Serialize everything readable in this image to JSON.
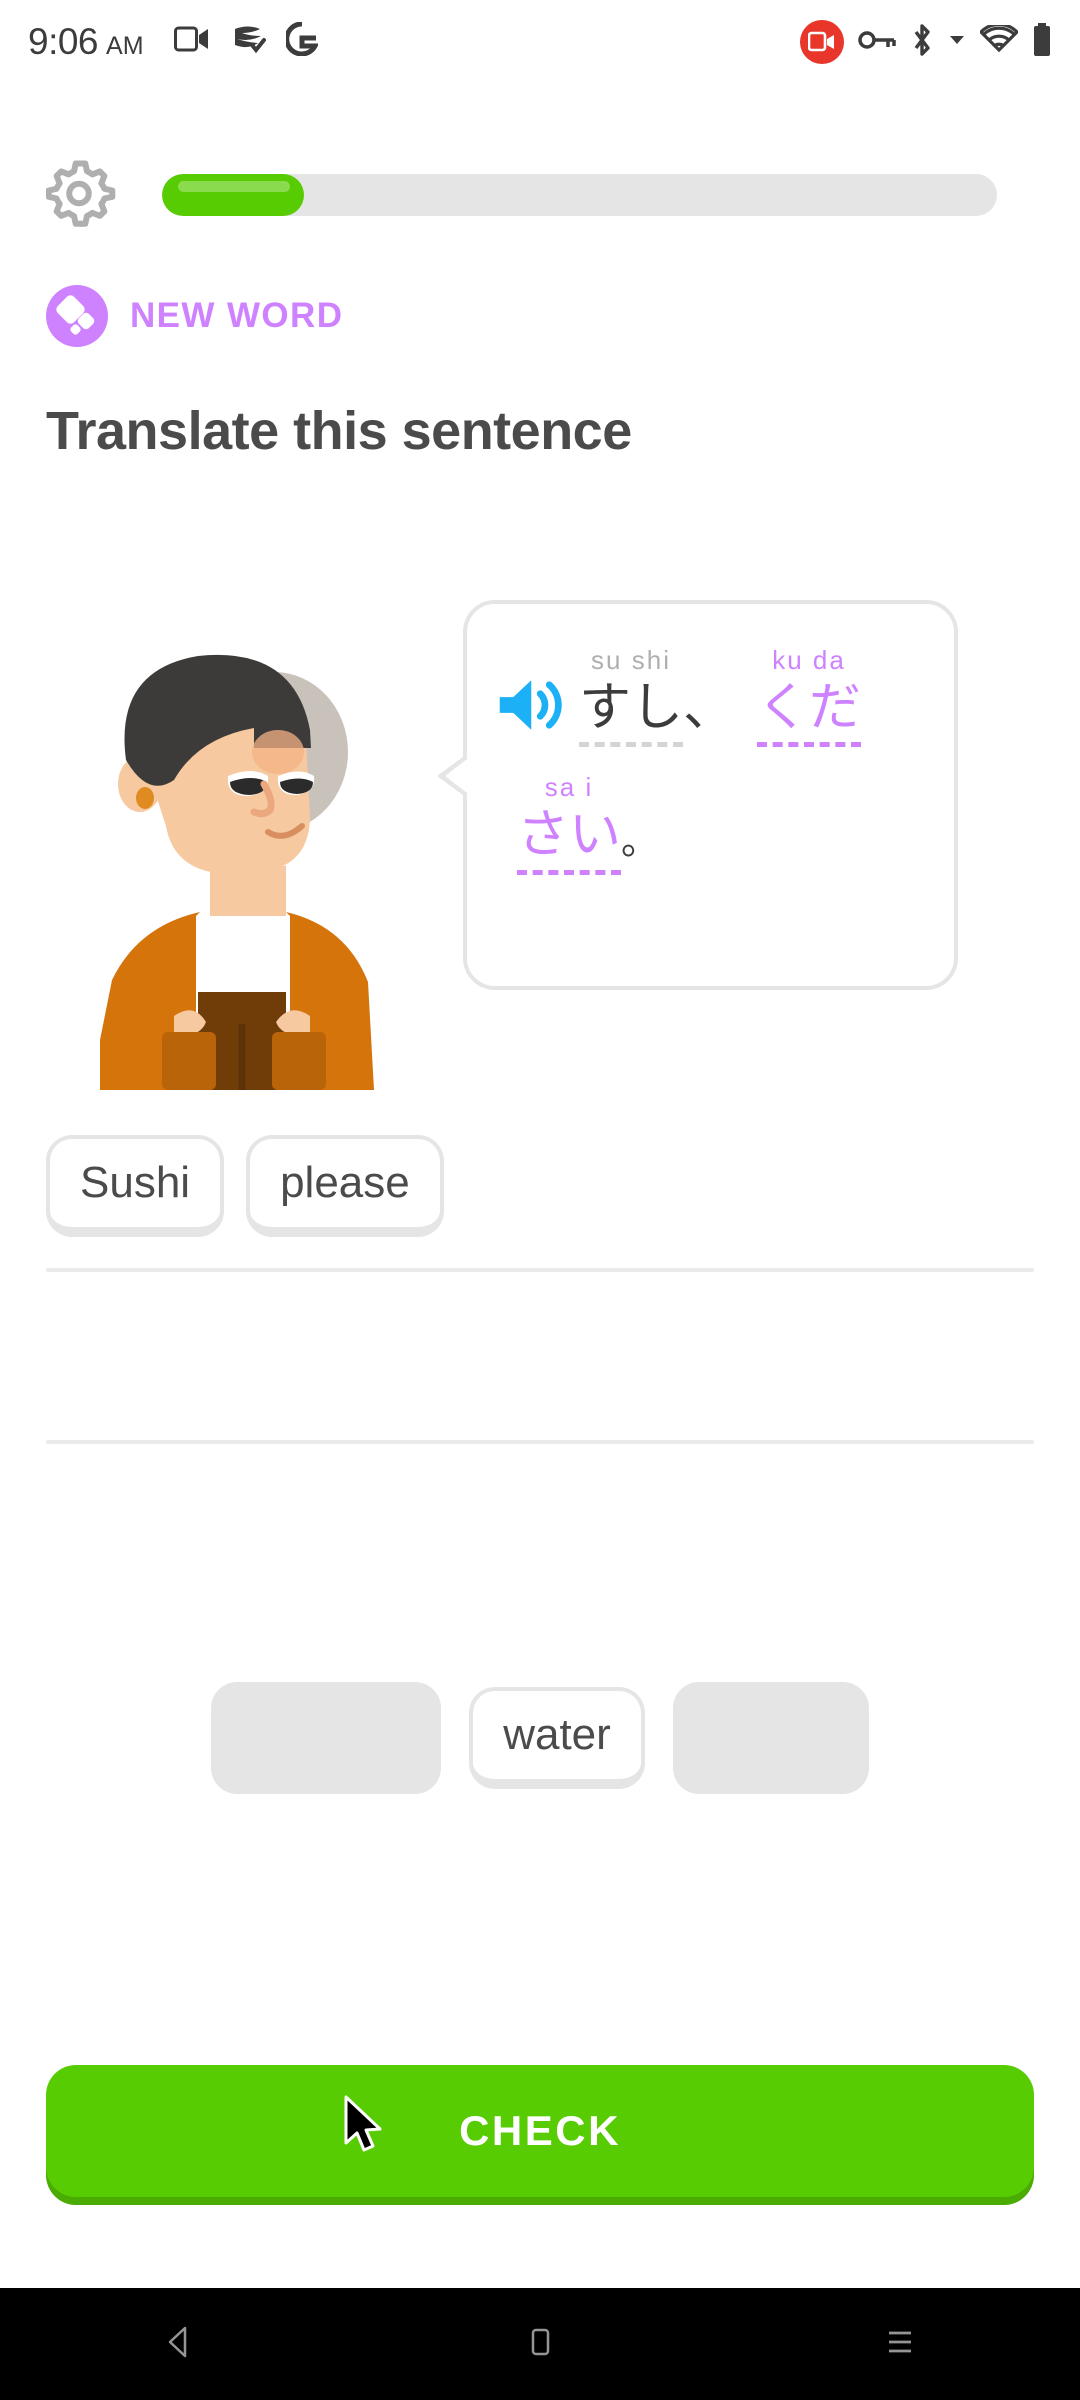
{
  "status_bar": {
    "time": "9:06",
    "ampm": "AM",
    "icons": [
      "screen-record-icon",
      "duolingo-icon",
      "google-icon",
      "screen-record-active-icon",
      "vpn-key-icon",
      "bluetooth-icon",
      "wifi-icon",
      "battery-icon"
    ]
  },
  "header": {
    "settings_icon": "gear-icon",
    "progress_percent": 17,
    "progress_fill_color": "#58cc02",
    "progress_track_color": "#e5e5e5"
  },
  "challenge": {
    "badge_label": "NEW WORD",
    "badge_color": "#ce82ff",
    "title": "Translate this sentence"
  },
  "prompt": {
    "speaker_icon": "speaker-icon",
    "speaker_color": "#1cb0f6",
    "character": "vikram-character",
    "line1": [
      {
        "furigana": "su shi",
        "base": "すし",
        "color": "gray"
      },
      {
        "furigana": "",
        "base": "、",
        "color": "plain"
      },
      {
        "furigana": "ku da",
        "base": "くだ",
        "color": "purple"
      }
    ],
    "line2": [
      {
        "furigana": "sa i",
        "base": "さい",
        "color": "purple"
      },
      {
        "furigana": "",
        "base": "。",
        "color": "plain"
      }
    ],
    "full_text": "すし、ください。"
  },
  "answer": {
    "row1_tiles": [
      "Sushi",
      "please"
    ],
    "row2_tiles": []
  },
  "word_bank": {
    "tiles": [
      {
        "label": "",
        "state": "used"
      },
      {
        "label": "water",
        "state": "available"
      },
      {
        "label": "",
        "state": "used"
      }
    ]
  },
  "footer": {
    "check_label": "CHECK",
    "check_color": "#58cc02",
    "cursor": "mouse-pointer"
  },
  "nav_bar": {
    "back": "back-triangle-icon",
    "home": "home-square-icon",
    "recents": "recents-menu-icon"
  }
}
